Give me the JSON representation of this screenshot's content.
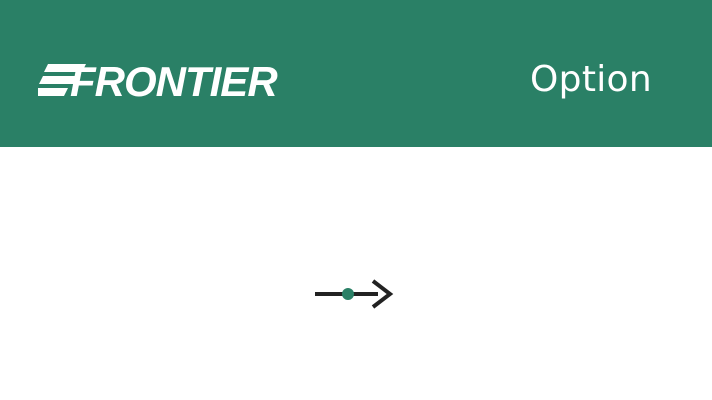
{
  "header": {
    "brand_name": "FRONTIER",
    "title": "Option"
  },
  "content": {
    "route_icon": "arrow-right-with-dot-icon"
  },
  "colors": {
    "header_bg": "#2a8066",
    "header_text": "#ffffff",
    "icon_stroke": "#222222",
    "icon_dot": "#2a8066",
    "page_bg": "#ffffff"
  }
}
